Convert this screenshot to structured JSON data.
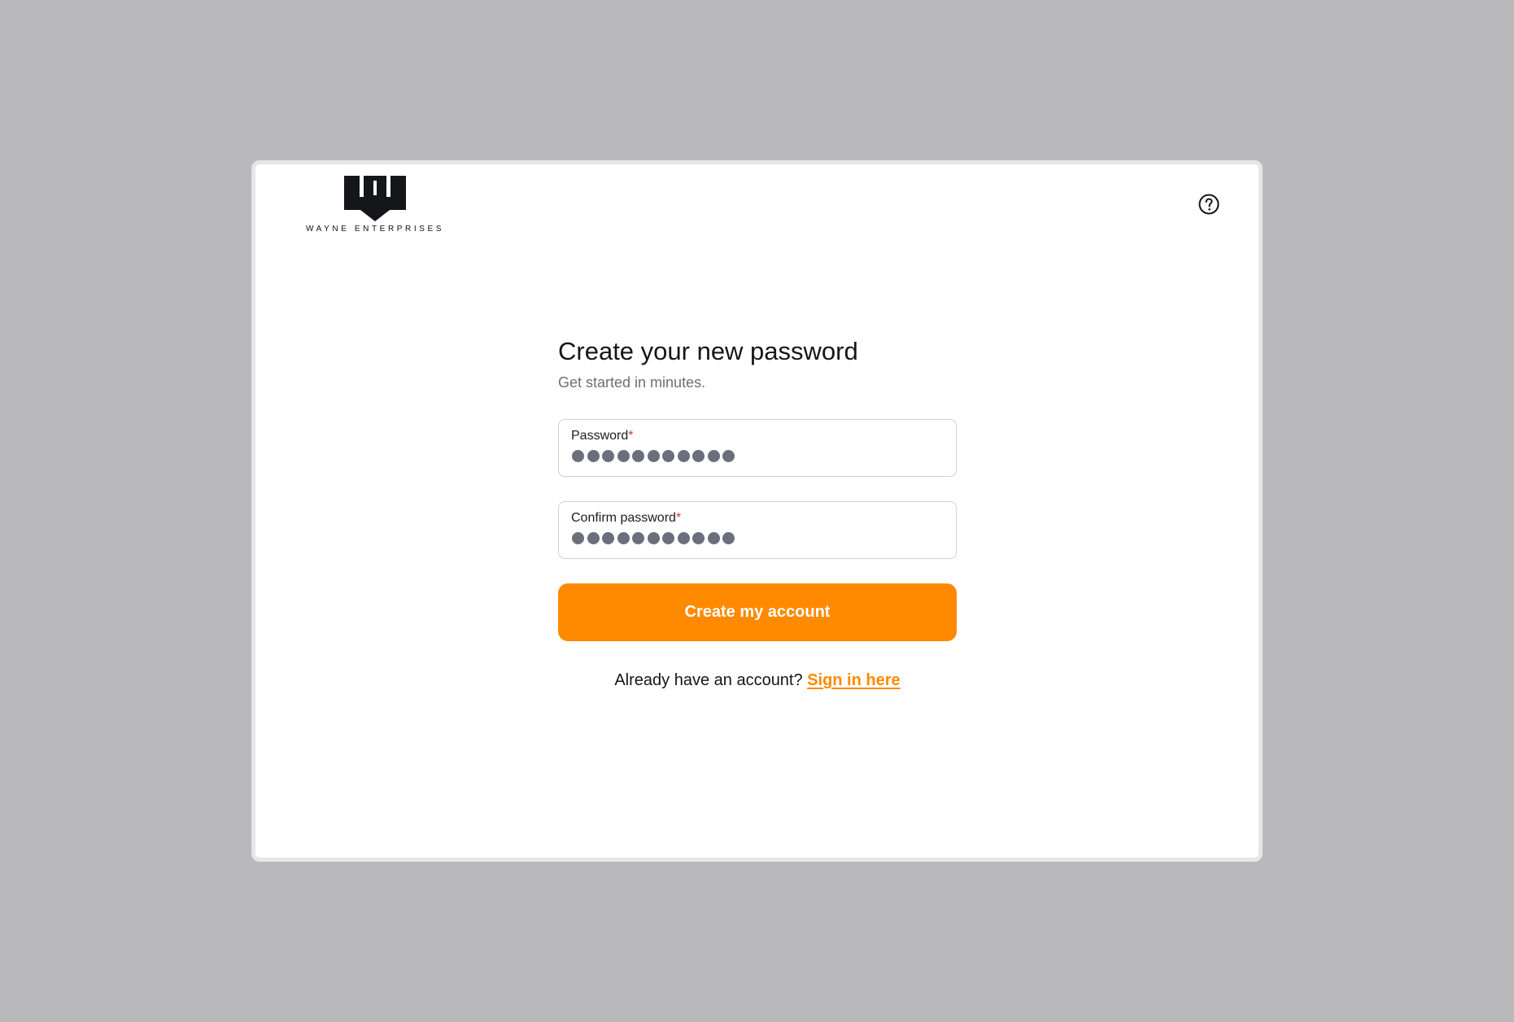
{
  "brand": {
    "logo_icon": "wayne-w-shield-icon",
    "name": "WAYNE ENTERPRISES"
  },
  "header": {
    "help_icon": "question-circle-icon"
  },
  "form": {
    "title": "Create your new password",
    "subtitle": "Get started in minutes.",
    "password": {
      "label": "Password",
      "required_mark": "*",
      "masked_length": 11
    },
    "confirm_password": {
      "label": "Confirm password",
      "required_mark": "*",
      "masked_length": 11
    },
    "submit_label": "Create my account",
    "signin_prompt": "Already have an account? ",
    "signin_link": "Sign in here"
  },
  "colors": {
    "accent": "#ff8a00",
    "required": "#e0342f",
    "backdrop": "#b9b9bb"
  }
}
